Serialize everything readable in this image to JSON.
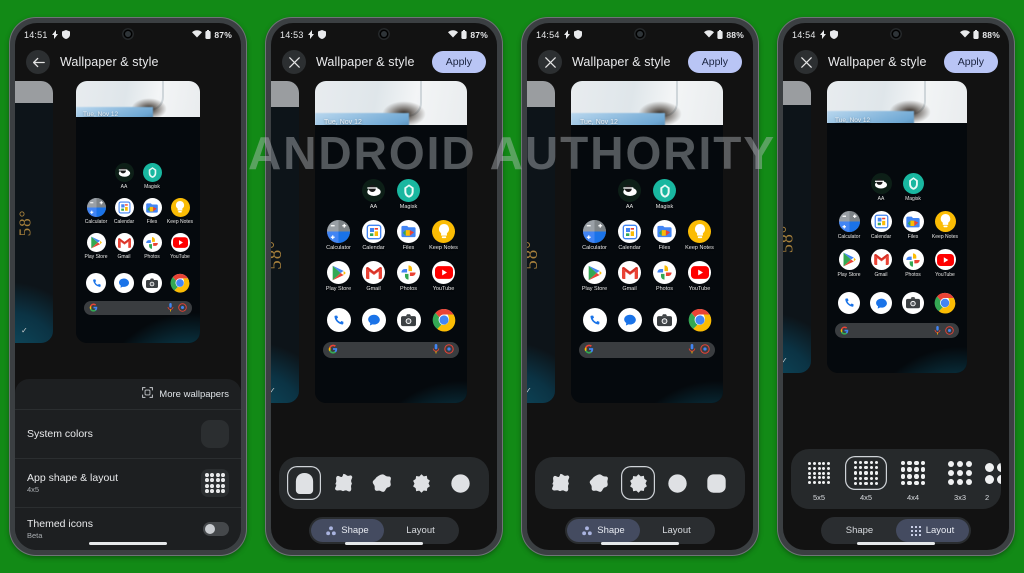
{
  "watermark": "ANDROID AUTHORITY",
  "brand": {
    "background_color": "#128a16",
    "accent_color": "#b9c5f5",
    "panel_color": "#26292b"
  },
  "phones": [
    {
      "id": "phone-1",
      "status": {
        "time": "14:51",
        "battery": "87%",
        "icons": [
          "flash-icon",
          "vpn-shield-icon",
          "wifi-icon",
          "battery-icon"
        ]
      },
      "appbar": {
        "nav_icon": "back-arrow-icon",
        "title": "Wallpaper & style",
        "apply_label": null
      },
      "mode": "settings-list",
      "settings": {
        "more_wallpapers": "More wallpapers",
        "more_wallpapers_icon": "wallpaper-frame-icon",
        "rows": [
          {
            "title": "System colors",
            "subtitle": "",
            "control": "color-swatch"
          },
          {
            "title": "App shape & layout",
            "subtitle": "4x5",
            "control": "grid-preview"
          },
          {
            "title": "Themed icons",
            "subtitle": "Beta",
            "control": "toggle-off"
          }
        ]
      }
    },
    {
      "id": "phone-2",
      "status": {
        "time": "14:53",
        "battery": "87%",
        "icons": [
          "flash-icon",
          "vpn-shield-icon",
          "wifi-icon",
          "battery-icon"
        ]
      },
      "appbar": {
        "nav_icon": "close-icon",
        "title": "Wallpaper & style",
        "apply_label": "Apply"
      },
      "mode": "shape-editor",
      "editor": {
        "tabs": [
          {
            "label": "Shape",
            "icon": "shape-icon",
            "active": true
          },
          {
            "label": "Layout",
            "icon": "grid-icon",
            "active": false
          }
        ],
        "shapes": [
          {
            "name": "arch",
            "selected": true
          },
          {
            "name": "clover",
            "selected": false
          },
          {
            "name": "blob-heptagon",
            "selected": false
          },
          {
            "name": "cog-burst",
            "selected": false
          },
          {
            "name": "circle",
            "selected": false
          }
        ]
      }
    },
    {
      "id": "phone-3",
      "status": {
        "time": "14:54",
        "battery": "88%",
        "icons": [
          "flash-icon",
          "vpn-shield-icon",
          "wifi-icon",
          "battery-icon"
        ]
      },
      "appbar": {
        "nav_icon": "close-icon",
        "title": "Wallpaper & style",
        "apply_label": "Apply"
      },
      "mode": "shape-editor",
      "editor": {
        "tabs": [
          {
            "label": "Shape",
            "icon": "shape-icon",
            "active": true
          },
          {
            "label": "Layout",
            "icon": "grid-icon",
            "active": false
          }
        ],
        "shapes": [
          {
            "name": "clover",
            "selected": false
          },
          {
            "name": "blob-heptagon",
            "selected": false
          },
          {
            "name": "cog-burst",
            "selected": true
          },
          {
            "name": "circle",
            "selected": false
          },
          {
            "name": "squircle",
            "selected": false
          }
        ]
      }
    },
    {
      "id": "phone-4",
      "status": {
        "time": "14:54",
        "battery": "88%",
        "icons": [
          "flash-icon",
          "vpn-shield-icon",
          "wifi-icon",
          "battery-icon"
        ]
      },
      "appbar": {
        "nav_icon": "close-icon",
        "title": "Wallpaper & style",
        "apply_label": "Apply"
      },
      "mode": "layout-editor",
      "editor": {
        "tabs": [
          {
            "label": "Shape",
            "icon": "shape-icon",
            "active": false
          },
          {
            "label": "Layout",
            "icon": "grid-icon",
            "active": true
          }
        ],
        "layouts": [
          {
            "label": "5x5",
            "cols": 5,
            "rows": 5,
            "selected": false
          },
          {
            "label": "4x5",
            "cols": 5,
            "rows": 5,
            "selected": true
          },
          {
            "label": "4x4",
            "cols": 4,
            "rows": 4,
            "selected": false
          },
          {
            "label": "3x3",
            "cols": 3,
            "rows": 3,
            "selected": false
          },
          {
            "label": "2",
            "cols": 2,
            "rows": 2,
            "selected": false
          }
        ]
      }
    }
  ],
  "home_preview": {
    "date": "Tue, Nov 12",
    "temperature": "58°",
    "search": {
      "leading_icon": "google-g-icon",
      "mic_icon": "microphone-icon",
      "lens_icon": "google-lens-icon"
    },
    "rows": [
      [
        {
          "label": "AA",
          "icon": "android-authority-icon"
        },
        {
          "label": "Magisk",
          "icon": "magisk-icon"
        }
      ],
      [
        {
          "label": "Calculator",
          "icon": "calculator-icon"
        },
        {
          "label": "Calendar",
          "icon": "calendar-icon"
        },
        {
          "label": "Files",
          "icon": "files-icon"
        },
        {
          "label": "Keep Notes",
          "icon": "keep-notes-icon"
        }
      ],
      [
        {
          "label": "Play Store",
          "icon": "play-store-icon"
        },
        {
          "label": "Gmail",
          "icon": "gmail-icon"
        },
        {
          "label": "Photos",
          "icon": "google-photos-icon"
        },
        {
          "label": "YouTube",
          "icon": "youtube-icon"
        }
      ]
    ],
    "dock": [
      {
        "label": "Phone",
        "icon": "phone-icon"
      },
      {
        "label": "Messages",
        "icon": "messages-icon"
      },
      {
        "label": "Camera",
        "icon": "camera-icon"
      },
      {
        "label": "Chrome",
        "icon": "chrome-icon"
      }
    ]
  }
}
